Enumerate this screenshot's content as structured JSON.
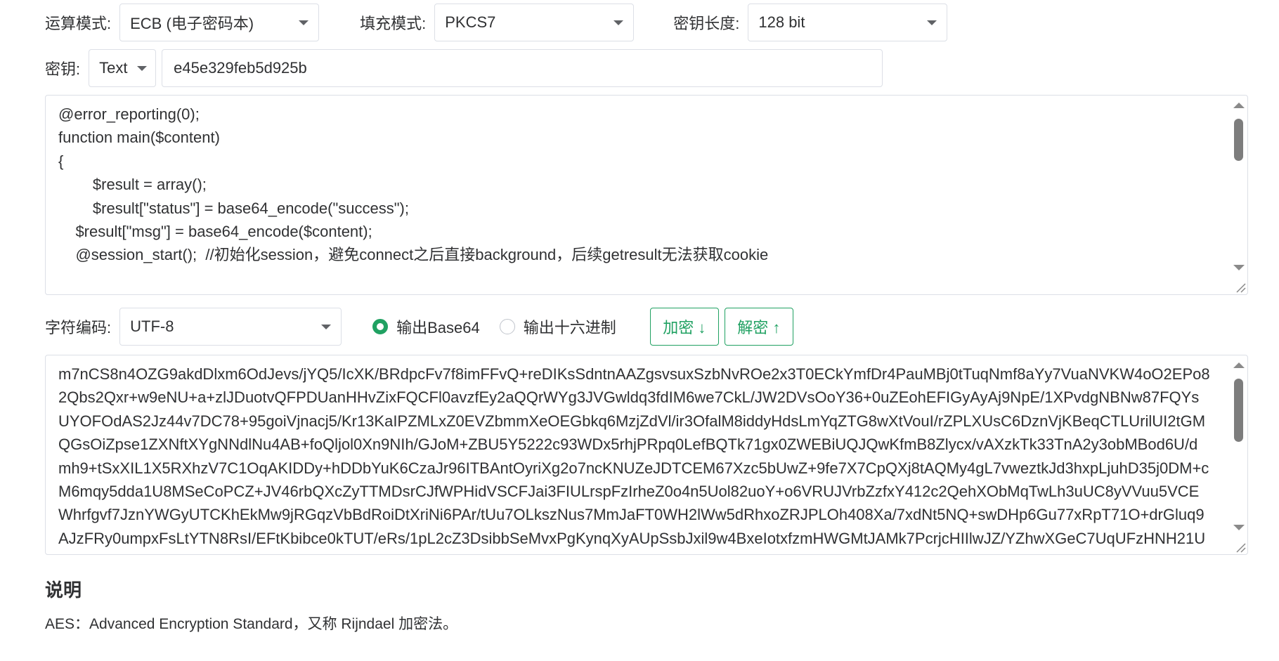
{
  "mode": {
    "label": "运算模式:",
    "value": "ECB (电子密码本)"
  },
  "padding": {
    "label": "填充模式:",
    "value": "PKCS7"
  },
  "key_length": {
    "label": "密钥长度:",
    "value": "128 bit"
  },
  "key": {
    "label": "密钥:",
    "format": "Text",
    "value": "e45e329feb5d925b"
  },
  "input_lines": [
    "@error_reporting(0);",
    "function main($content)",
    "{",
    "        $result = array();",
    "        $result[\"status\"] = base64_encode(\"success\");",
    "    $result[\"msg\"] = base64_encode($content);",
    "    @session_start();  //初始化session，避免connect之后直接background，后续getresult无法获取cookie"
  ],
  "charset": {
    "label": "字符编码:",
    "value": "UTF-8"
  },
  "output_options": [
    {
      "label": "输出Base64",
      "selected": true
    },
    {
      "label": "输出十六进制",
      "selected": false
    }
  ],
  "buttons": {
    "encrypt": "加密 ↓",
    "decrypt": "解密 ↑"
  },
  "output_lines": [
    "m7nCS8n4OZG9akdDlxm6OdJevs/jYQ5/IcXK/BRdpcFv7f8imFFvQ+reDIKsSdntnAAZgsvsuxSzbNvROe2x3T0ECkYmfDr4PauMBj0tTuqNmf8aYy7VuaNVKW4oO2EPo8",
    "2Qbs2Qxr+w9eNU+a+zlJDuotvQFPDUanHHvZixFQCFl0avzfEy2aQQrWYg3JVGwldq3fdIM6we7CkL/JW2DVsOoY36+0uZEohEFIGyAyAj9NpE/1XPvdgNBNw87FQYs",
    "UYOFOdAS2Jz44v7DC78+95goiVjnacj5/Kr13KaIPZMLxZ0EVZbmmXeOEGbkq6MzjZdVl/ir3OfalM8iddyHdsLmYqZTG8wXtVouI/rZPLXUsC6DznVjKBeqCTLUrilUI2tGM",
    "QGsOiZpse1ZXNftXYgNNdlNu4AB+foQljol0Xn9NIh/GJoM+ZBU5Y5222c93WDx5rhjPRpq0LefBQTk71gx0ZWEBiUQJQwKfmB8Zlycx/vAXzkTk33TnA2y3obMBod6U/d",
    "mh9+tSxXIL1X5RXhzV7C1OqAKIDDy+hDDbYuK6CzaJr96ITBAntOyriXg2o7ncKNUZeJDTCEM67Xzc5bUwZ+9fe7X7CpQXj8tAQMy4gL7vweztkJd3hxpLjuhD35j0DM+c",
    "M6mqy5dda1U8MSeCoPCZ+JV46rbQXcZyTTMDsrCJfWPHidVSCFJai3FIULrspFzIrheZ0o4n5Uol82uoY+o6VRUJVrbZzfxY412c2QehXObMqTwLh3uUC8yVVuu5VCE",
    "Whrfgvf7JznYWGyUTCKhEkMw9jRGqzVbBdRoiDtXriNi6PAr/tUu7OLkszNus7MmJaFT0WH2lWw5dRhxoZRJPLOh408Xa/7xdNt5NQ+swDHp6Gu77xRpT71O+drGluq9",
    "AJzFRy0umpxFsLtYTN8RsI/EFtKbibce0kTUT/eRs/1pL2cZ3DsibbSeMvxPgKynqXyAUpSsbJxil9w4BxeIotxfzmHWGMtJAMk7PcrjcHIIlwJZ/YZhwXGeC7UqUFzHNH21U"
  ],
  "notes": {
    "heading": "说明",
    "text": "AES：Advanced Encryption Standard，又称 Rijndael 加密法。"
  }
}
